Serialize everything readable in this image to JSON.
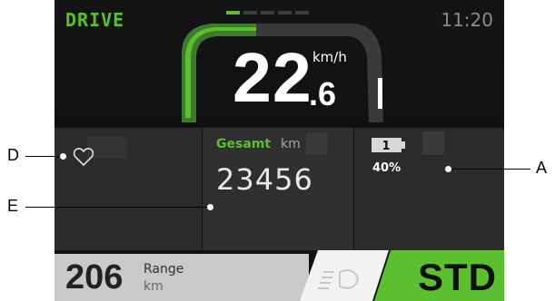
{
  "header": {
    "mode": "DRIVE",
    "time": "11:20",
    "page_indicator": {
      "pages": 5,
      "active": 1
    }
  },
  "speed": {
    "integer": "22",
    "decimal": ".6",
    "unit": "km/h"
  },
  "odometer": {
    "label": "Gesamt",
    "unit": "km",
    "value": "23456"
  },
  "battery": {
    "level_number": "1",
    "percent": "40%",
    "icon": "battery-icon"
  },
  "favorite": {
    "icon": "heart-icon"
  },
  "range": {
    "value": "206",
    "label": "Range",
    "unit": "km"
  },
  "light": {
    "icon": "headlight-icon"
  },
  "assist_mode": {
    "label": "STD"
  },
  "callouts": {
    "a": "A",
    "d": "D",
    "e": "E"
  },
  "colors": {
    "accent_green": "#5cbf2f",
    "screen_bg": "#121212",
    "tile_bg": "#2b2b2b",
    "range_bg": "#c9c9c9"
  }
}
